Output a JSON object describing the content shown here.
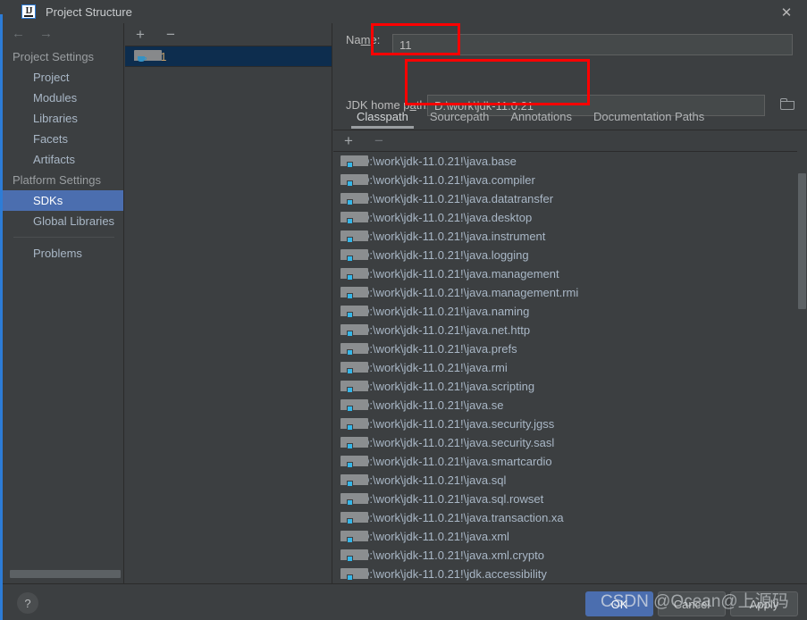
{
  "window": {
    "title": "Project Structure",
    "app_icon": "intellij-idea-icon",
    "close_label": "✕"
  },
  "nav_toolbar": {
    "back_label": "←",
    "forward_label": "→"
  },
  "sidebar": {
    "groups": [
      {
        "label": "Project Settings",
        "items": [
          {
            "label": "Project",
            "selected": false
          },
          {
            "label": "Modules",
            "selected": false
          },
          {
            "label": "Libraries",
            "selected": false
          },
          {
            "label": "Facets",
            "selected": false
          },
          {
            "label": "Artifacts",
            "selected": false
          }
        ]
      },
      {
        "label": "Platform Settings",
        "items": [
          {
            "label": "SDKs",
            "selected": true
          },
          {
            "label": "Global Libraries",
            "selected": false
          }
        ]
      }
    ],
    "problems": {
      "label": "Problems"
    }
  },
  "sdk_pane": {
    "toolbar": {
      "add_label": "+",
      "remove_label": "−"
    },
    "items": [
      {
        "label": "11",
        "selected": true,
        "icon": "jdk-icon"
      }
    ]
  },
  "detail": {
    "name_field": {
      "label_before": "Na",
      "label_mnemonic": "m",
      "label_after": "e:",
      "value": "11",
      "placeholder": ""
    },
    "jdk_home_field": {
      "label_before": "JDK home p",
      "label_mnemonic": "a",
      "label_after": "th:",
      "value": "D:\\work\\jdk-11.0.21",
      "placeholder": "",
      "browse_icon": "folder-browse-icon"
    },
    "tabs": [
      {
        "label": "Classpath",
        "active": true
      },
      {
        "label": "Sourcepath",
        "active": false
      },
      {
        "label": "Annotations",
        "active": false
      },
      {
        "label": "Documentation Paths",
        "active": false
      }
    ],
    "classpath_toolbar": {
      "add_label": "+",
      "remove_label": "−"
    },
    "classpath_entries": [
      "D:\\work\\jdk-11.0.21!\\java.base",
      "D:\\work\\jdk-11.0.21!\\java.compiler",
      "D:\\work\\jdk-11.0.21!\\java.datatransfer",
      "D:\\work\\jdk-11.0.21!\\java.desktop",
      "D:\\work\\jdk-11.0.21!\\java.instrument",
      "D:\\work\\jdk-11.0.21!\\java.logging",
      "D:\\work\\jdk-11.0.21!\\java.management",
      "D:\\work\\jdk-11.0.21!\\java.management.rmi",
      "D:\\work\\jdk-11.0.21!\\java.naming",
      "D:\\work\\jdk-11.0.21!\\java.net.http",
      "D:\\work\\jdk-11.0.21!\\java.prefs",
      "D:\\work\\jdk-11.0.21!\\java.rmi",
      "D:\\work\\jdk-11.0.21!\\java.scripting",
      "D:\\work\\jdk-11.0.21!\\java.se",
      "D:\\work\\jdk-11.0.21!\\java.security.jgss",
      "D:\\work\\jdk-11.0.21!\\java.security.sasl",
      "D:\\work\\jdk-11.0.21!\\java.smartcardio",
      "D:\\work\\jdk-11.0.21!\\java.sql",
      "D:\\work\\jdk-11.0.21!\\java.sql.rowset",
      "D:\\work\\jdk-11.0.21!\\java.transaction.xa",
      "D:\\work\\jdk-11.0.21!\\java.xml",
      "D:\\work\\jdk-11.0.21!\\java.xml.crypto",
      "D:\\work\\jdk-11.0.21!\\jdk.accessibility"
    ]
  },
  "footer": {
    "help_label": "?",
    "ok_label": "OK",
    "cancel_label": "Cancel",
    "apply_label": "Apply"
  },
  "watermark": {
    "prefix": "CSDN",
    "text": " @Ocean@上源码"
  },
  "colors": {
    "background": "#3c3f41",
    "selection_blue": "#4b6eaf",
    "sdk_row_selection": "#0d2d4e",
    "sdk_label": "#c9a26a",
    "path_text": "#a9b7c6",
    "annotation_red": "#ff0000",
    "accent_strip": "#2d7cd6"
  }
}
